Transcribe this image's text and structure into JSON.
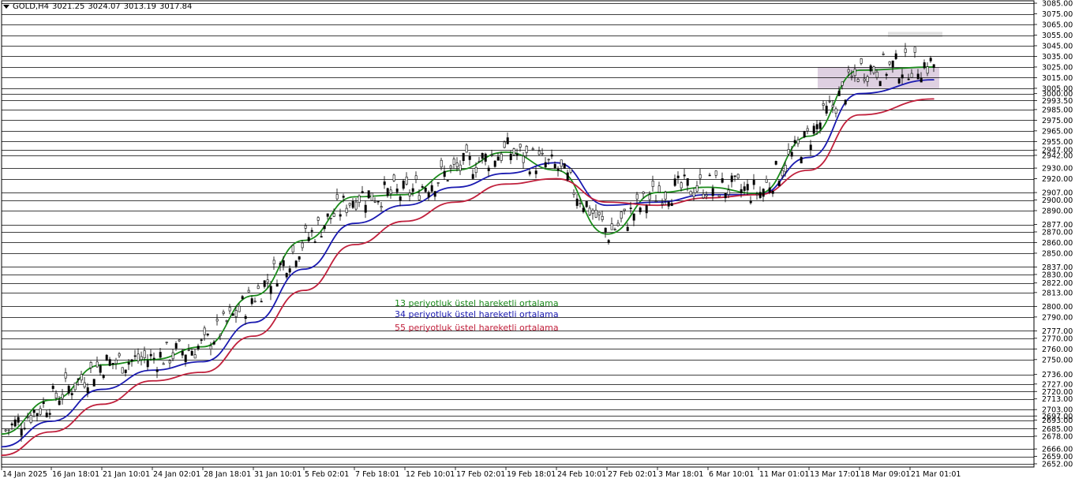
{
  "header": {
    "symbol": "GOLD,H4",
    "open": "3021.25",
    "high": "3024.07",
    "low": "3013.19",
    "close": "3017.84"
  },
  "legend": [
    {
      "label": "13 periyotluk üstel hareketli ortalama",
      "color": "#1a8a1a"
    },
    {
      "label": "34 periyotluk üstel hareketli ortalama",
      "color": "#1a1ab0"
    },
    {
      "label": "55 periyotluk üstel hareketli ortalama",
      "color": "#c0203c"
    }
  ],
  "chart_data": {
    "type": "line",
    "ylim": [
      2649,
      3088
    ],
    "x": [
      "14 Jan 2025",
      "16 Jan 18:01",
      "21 Jan 10:01",
      "24 Jan 02:01",
      "28 Jan 18:01",
      "31 Jan 10:01",
      "5 Feb 02:01",
      "7 Feb 18:01",
      "12 Feb 10:01",
      "17 Feb 02:01",
      "19 Feb 18:01",
      "24 Feb 10:01",
      "27 Feb 02:01",
      "3 Mar 18:01",
      "6 Mar 10:01",
      "11 Mar 01:01",
      "13 Mar 17:01",
      "18 Mar 09:01",
      "21 Mar 01:01"
    ],
    "y_ticks": [
      "3085.00",
      "3075.00",
      "3065.00",
      "3055.00",
      "3045.00",
      "3035.00",
      "3025.00",
      "3015.00",
      "3005.00",
      "3000.00",
      "2993.50",
      "2985.00",
      "2975.00",
      "2965.00",
      "2955.00",
      "2947.00",
      "2942.00",
      "2930.00",
      "2920.00",
      "2907.00",
      "2900.00",
      "2890.00",
      "2877.00",
      "2870.00",
      "2860.00",
      "2850.00",
      "2837.00",
      "2830.00",
      "2822.00",
      "2813.00",
      "2800.00",
      "2790.00",
      "2777.00",
      "2770.00",
      "2760.00",
      "2750.00",
      "2736.00",
      "2727.00",
      "2720.00",
      "2713.00",
      "2703.00",
      "2697.00",
      "2693.00",
      "2685.00",
      "2678.00",
      "2666.00",
      "2659.00",
      "2652.00"
    ],
    "price_lines": [
      3085,
      3075,
      3065,
      3055,
      3045,
      3035,
      3025,
      3015,
      3005,
      3000,
      2993.5,
      2985,
      2975,
      2965,
      2955,
      2947,
      2942,
      2930,
      2920,
      2907,
      2900,
      2890,
      2877,
      2870,
      2860,
      2850,
      2837,
      2830,
      2822,
      2813,
      2800,
      2790,
      2777,
      2770,
      2760,
      2750,
      2736,
      2727,
      2720,
      2713,
      2703,
      2697,
      2693,
      2685,
      2678,
      2666,
      2659,
      2652
    ],
    "series": [
      {
        "name": "13 periyotluk üstel hareketli ortalama",
        "color": "#1a8a1a",
        "values": [
          2680,
          2712,
          2745,
          2750,
          2762,
          2810,
          2862,
          2903,
          2905,
          2928,
          2945,
          2928,
          2868,
          2907,
          2912,
          2906,
          2960,
          3022,
          3025
        ]
      },
      {
        "name": "34 periyotluk üstel hareketli ortalama",
        "color": "#1a1ab0",
        "values": [
          2668,
          2692,
          2722,
          2740,
          2748,
          2785,
          2835,
          2878,
          2895,
          2912,
          2925,
          2935,
          2895,
          2898,
          2905,
          2905,
          2940,
          3000,
          3013
        ]
      },
      {
        "name": "55 periyotluk üstel hareketli ortalama",
        "color": "#c0203c",
        "values": [
          2660,
          2682,
          2708,
          2730,
          2738,
          2772,
          2815,
          2858,
          2880,
          2898,
          2915,
          2920,
          2898,
          2895,
          2902,
          2905,
          2928,
          2980,
          2995
        ]
      }
    ],
    "zones": [
      {
        "from": 3005,
        "to": 3025,
        "color": "#d8c8dc"
      },
      {
        "from": 3053,
        "to": 3058,
        "color": "#dadada"
      }
    ]
  }
}
